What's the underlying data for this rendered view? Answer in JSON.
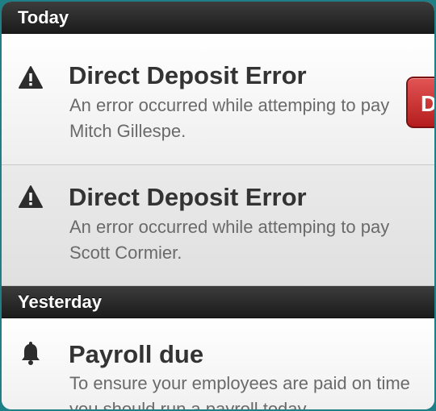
{
  "sections": [
    {
      "header": "Today",
      "items": [
        {
          "icon": "warning-icon",
          "title": "Direct Deposit Error",
          "message": "An error occurred while attemping to pay Mitch Gillespe.",
          "action_label": "D"
        },
        {
          "icon": "warning-icon",
          "title": "Direct Deposit Error",
          "message": "An error occurred while attemping to pay Scott Cormier."
        }
      ]
    },
    {
      "header": "Yesterday",
      "items": [
        {
          "icon": "bell-icon",
          "title": "Payroll due",
          "message": "To ensure your employees are paid on time you should run a payroll today."
        }
      ]
    }
  ],
  "colors": {
    "frame": "#1e7f86",
    "header_bg": "#2b2b2b",
    "delete_button": "#cc2a2a",
    "title_text": "#333333",
    "message_text": "#6a6a6a"
  }
}
